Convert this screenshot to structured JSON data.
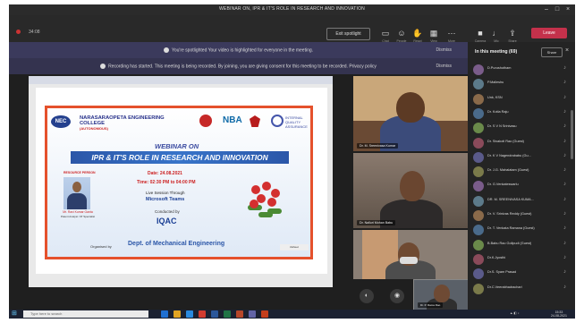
{
  "window": {
    "title": "WEBINAR ON, IPR & IT'S ROLE IN RESEARCH AND INNOVATION"
  },
  "toolbar": {
    "elapsed": "34:08",
    "exit_spotlight": "Exit spotlight",
    "leave": "Leave",
    "labels": [
      "Chat",
      "People",
      "React",
      "View",
      "More",
      "Camera",
      "Mic",
      "Share"
    ]
  },
  "banners": {
    "spotlight": "You're spotlighted  Your video is highlighted for everyone in the meeting.",
    "recording": "Recording has started. This meeting is being recorded. By joining, you are giving consent for this meeting to be recorded. Privacy policy",
    "dismiss": "Dismiss"
  },
  "poster": {
    "college_name": "NARASARAOPETA ENGINEERING COLLEGE",
    "college_sub": "(AUTONOMOUS)",
    "logo_nec": "NEC",
    "logo_nba": "NBA",
    "logo_iqac": "INTERNAL QUALITY ASSURANCE",
    "webinar_on": "WEBINAR ON",
    "title": "IPR & IT'S ROLE IN RESEARCH AND INNOVATION",
    "resource_person": "RESOURCE PERSON",
    "speaker_name": "Mr. Ravi Kumar Ganta",
    "speaker_role": "Patent Analyst / IP Specialist",
    "date": "Date: 24.08.2021",
    "time": "Time: 02:30 PM to 04:00 PM",
    "live": "Live Session Through",
    "platform": "Microsoft Teams",
    "conducted_by": "Conducted by",
    "iqac": "IQAC",
    "organised_by": "Organised by",
    "dept": "Dept. of Mechanical Engineering",
    "sheet_label": "ttisheet"
  },
  "videos": [
    "Dr. M. Sreenivasa Kumar",
    "Dr. Nalluri Mohan Babu",
    "Dr. P. Rama Rao"
  ],
  "panel": {
    "header": "In this meeting (69)",
    "share": "Share",
    "participants": [
      "D.Purushotham",
      "P.Malleshu",
      "Unk, KSN",
      "Dr. Kotla Raju",
      "Dr. S V N Srinivasu",
      "Dr. Sivakoti Rao (Guest)",
      "Dr. K V Nagendrababu (Gu...",
      "Dr. J.G. Mahalatam (Guest)",
      "Dr. G.Venkateswarlu",
      "DR. M. SREENIVASA KUMA...",
      "Dr. V. Srinivas Reddy (Guest)",
      "Dr. T. Venkata Ramana (Guest)",
      "B.Babu Rao Gollpudi (Guest)",
      "Dr.K.Jyosthi",
      "Dr.S. Syam Prasad",
      "Dr.C.Veerabhadrachari"
    ]
  },
  "taskbar": {
    "search_placeholder": "Type here to search",
    "time": "15:33",
    "date": "24-08-2021"
  }
}
